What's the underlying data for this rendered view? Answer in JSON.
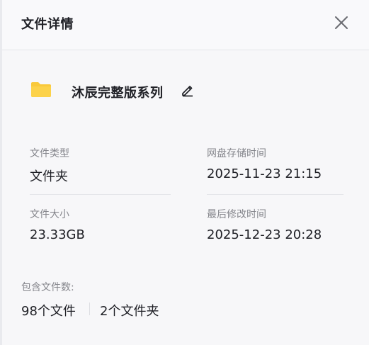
{
  "dialog": {
    "title": "文件详情",
    "close_icon": "close-icon"
  },
  "file": {
    "icon": "folder-icon",
    "icon_color": "#f9c93b",
    "name": "沐辰完整版系列",
    "edit_icon": "pencil-icon"
  },
  "details": {
    "type_label": "文件类型",
    "type_value": "文件夹",
    "stored_label": "网盘存储时间",
    "stored_value": "2025-11-23 21:15",
    "size_label": "文件大小",
    "size_value": "23.33GB",
    "modified_label": "最后修改时间",
    "modified_value": "2025-12-23 20:28"
  },
  "contents": {
    "label": "包含文件数:",
    "files": "98个文件",
    "folders": "2个文件夹"
  }
}
